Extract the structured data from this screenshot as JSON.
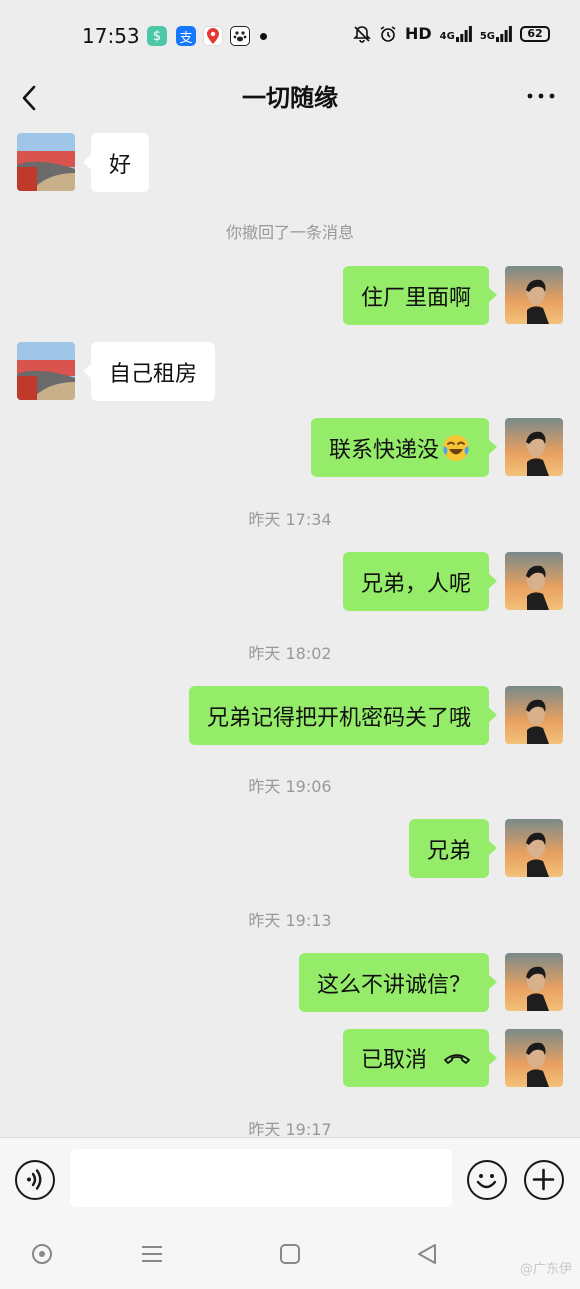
{
  "status_bar": {
    "time": "17:53",
    "network": "HD",
    "signal_1": "4G",
    "signal_2": "5G",
    "battery": "62"
  },
  "header": {
    "title": "一切随缘",
    "back_icon": "chevron-left-icon",
    "more_icon": "ellipsis-icon"
  },
  "messages": [
    {
      "side": "left",
      "text": "好"
    },
    {
      "side": "system",
      "text": "你撤回了一条消息"
    },
    {
      "side": "right",
      "text": "住厂里面啊"
    },
    {
      "side": "left",
      "text": "自己租房"
    },
    {
      "side": "right",
      "text": "联系快递没",
      "emoji": "laughing-tears-emoji"
    },
    {
      "side": "system",
      "text": "昨天 17:34"
    },
    {
      "side": "right",
      "text": "兄弟，人呢"
    },
    {
      "side": "system",
      "text": "昨天 18:02"
    },
    {
      "side": "right",
      "text": "兄弟记得把开机密码关了哦"
    },
    {
      "side": "system",
      "text": "昨天 19:06"
    },
    {
      "side": "right",
      "text": "兄弟"
    },
    {
      "side": "system",
      "text": "昨天 19:13"
    },
    {
      "side": "right",
      "text": "这么不讲诚信？"
    },
    {
      "side": "right",
      "text": "已取消",
      "call_icon": "hang-up-icon"
    },
    {
      "side": "system",
      "text": "昨天 19:17"
    }
  ],
  "input_bar": {
    "voice_icon": "voice-icon",
    "emoji_icon": "smiley-icon",
    "plus_icon": "plus-icon"
  },
  "watermark": "@广东伊",
  "colors": {
    "background": "#ededed",
    "bubble_sent": "#95ec69",
    "bubble_received": "#ffffff",
    "system_text": "#999999"
  }
}
